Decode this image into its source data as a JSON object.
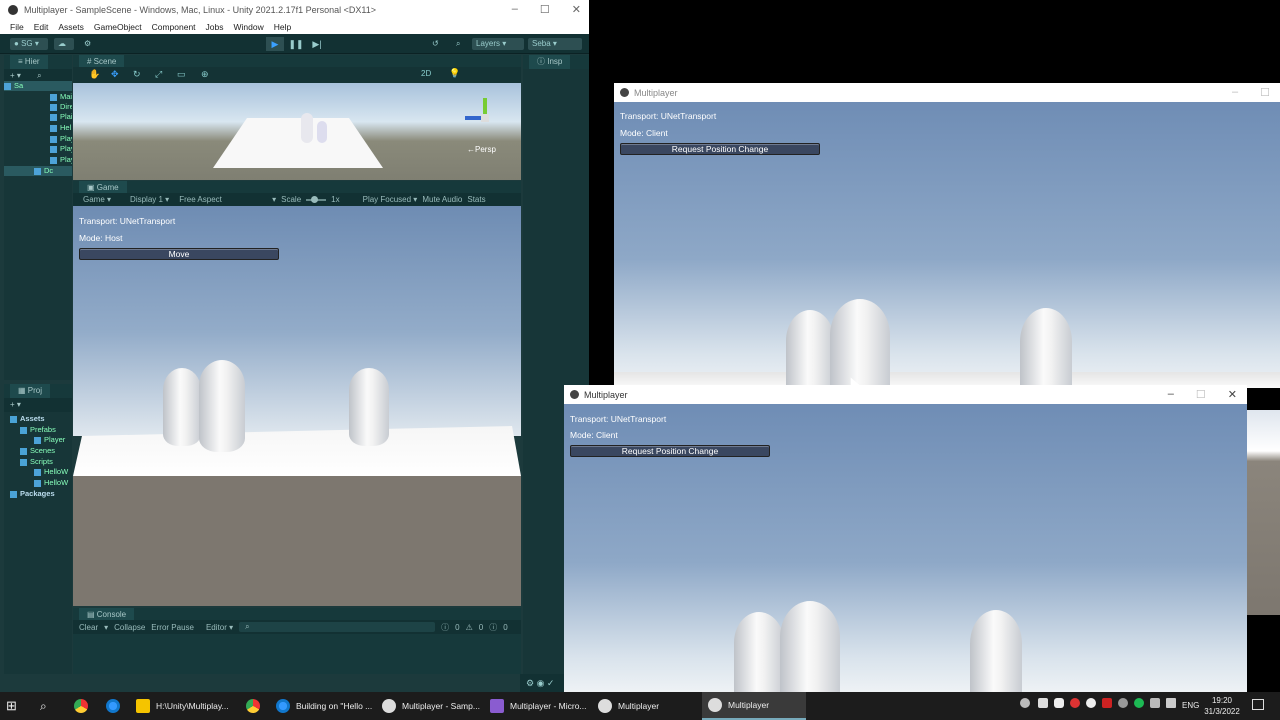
{
  "unity": {
    "title": "Multiplayer - SampleScene - Windows, Mac, Linux - Unity 2021.2.17f1 Personal <DX11>",
    "menu": [
      "File",
      "Edit",
      "Assets",
      "GameObject",
      "Component",
      "Jobs",
      "Window",
      "Help"
    ],
    "toolbar": {
      "account": "SG",
      "layers": "Layers",
      "layout": "Seba"
    },
    "hierarchy": {
      "tab": "Hier",
      "rows": [
        "Sa",
        "Mai",
        "Dire",
        "Plai",
        "Hel",
        "Play",
        "Play",
        "Play",
        "Dc"
      ]
    },
    "scene": {
      "tab": "Scene",
      "persp": "←Persp",
      "mode2d": "2D"
    },
    "game": {
      "tab": "Game",
      "bar": {
        "mode": "Game",
        "display": "Display 1",
        "aspect": "Free Aspect",
        "scale_label": "Scale",
        "scale_value": "1x",
        "play_focused": "Play Focused",
        "mute": "Mute Audio",
        "stats": "Stats"
      },
      "transport": "Transport: UNetTransport",
      "mode": "Mode: Host",
      "button": "Move"
    },
    "project": {
      "tab": "Proj",
      "rows": [
        "Assets",
        "Prefabs",
        "Player",
        "Scenes",
        "Scripts",
        "HelloW",
        "HelloW",
        "Packages"
      ]
    },
    "console": {
      "tab": "Console",
      "clear": "Clear",
      "collapse": "Collapse",
      "error_pause": "Error Pause",
      "editor": "Editor",
      "c1": "0",
      "c2": "0",
      "c3": "0"
    },
    "inspector": {
      "tab": "Insp"
    }
  },
  "client_window_1": {
    "title": "Multiplayer",
    "transport": "Transport: UNetTransport",
    "mode": "Mode: Client",
    "button": "Request Position Change"
  },
  "client_window_2": {
    "title": "Multiplayer",
    "transport": "Transport: UNetTransport",
    "mode": "Mode: Client",
    "button": "Request Position Change"
  },
  "taskbar": {
    "items": [
      "H:\\Unity\\Multiplay...",
      "Building on \"Hello ...",
      "Multiplayer - Samp...",
      "Multiplayer - Micro...",
      "Multiplayer",
      "Multiplayer"
    ],
    "lang": "ENG",
    "time": "19:20",
    "date": "31/3/2022"
  },
  "colors": {
    "sky_top": "#6f8db5",
    "sky_bottom": "#dde6ee",
    "ground": "#7d776f",
    "unity_bg": "#1c3a3c",
    "button_bg": "#3a4760"
  }
}
